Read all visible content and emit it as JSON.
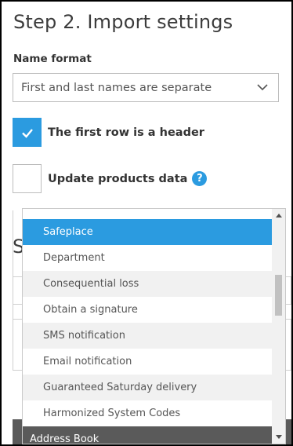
{
  "header": {
    "title": "Step 2. Import settings"
  },
  "name_format": {
    "label": "Name format",
    "selected": "First and last names are separate"
  },
  "options": {
    "first_row_header": {
      "label": "The first row is a header",
      "checked": true
    },
    "update_products": {
      "label": "Update products data",
      "checked": false,
      "help_icon": "question-circle-icon"
    }
  },
  "background": {
    "section_initial": "S"
  },
  "dropdown": {
    "items": [
      {
        "label": "Safeplace",
        "selected": true
      },
      {
        "label": "Department"
      },
      {
        "label": "Consequential loss"
      },
      {
        "label": "Obtain a signature"
      },
      {
        "label": "SMS notification"
      },
      {
        "label": "Email notification"
      },
      {
        "label": "Guaranteed Saturday delivery"
      },
      {
        "label": "Harmonized System Codes"
      }
    ],
    "group_header": "Address Book"
  },
  "colors": {
    "accent": "#2b9be0",
    "group_bg": "#5a5a5a",
    "alt_row": "#f1f1f1"
  }
}
